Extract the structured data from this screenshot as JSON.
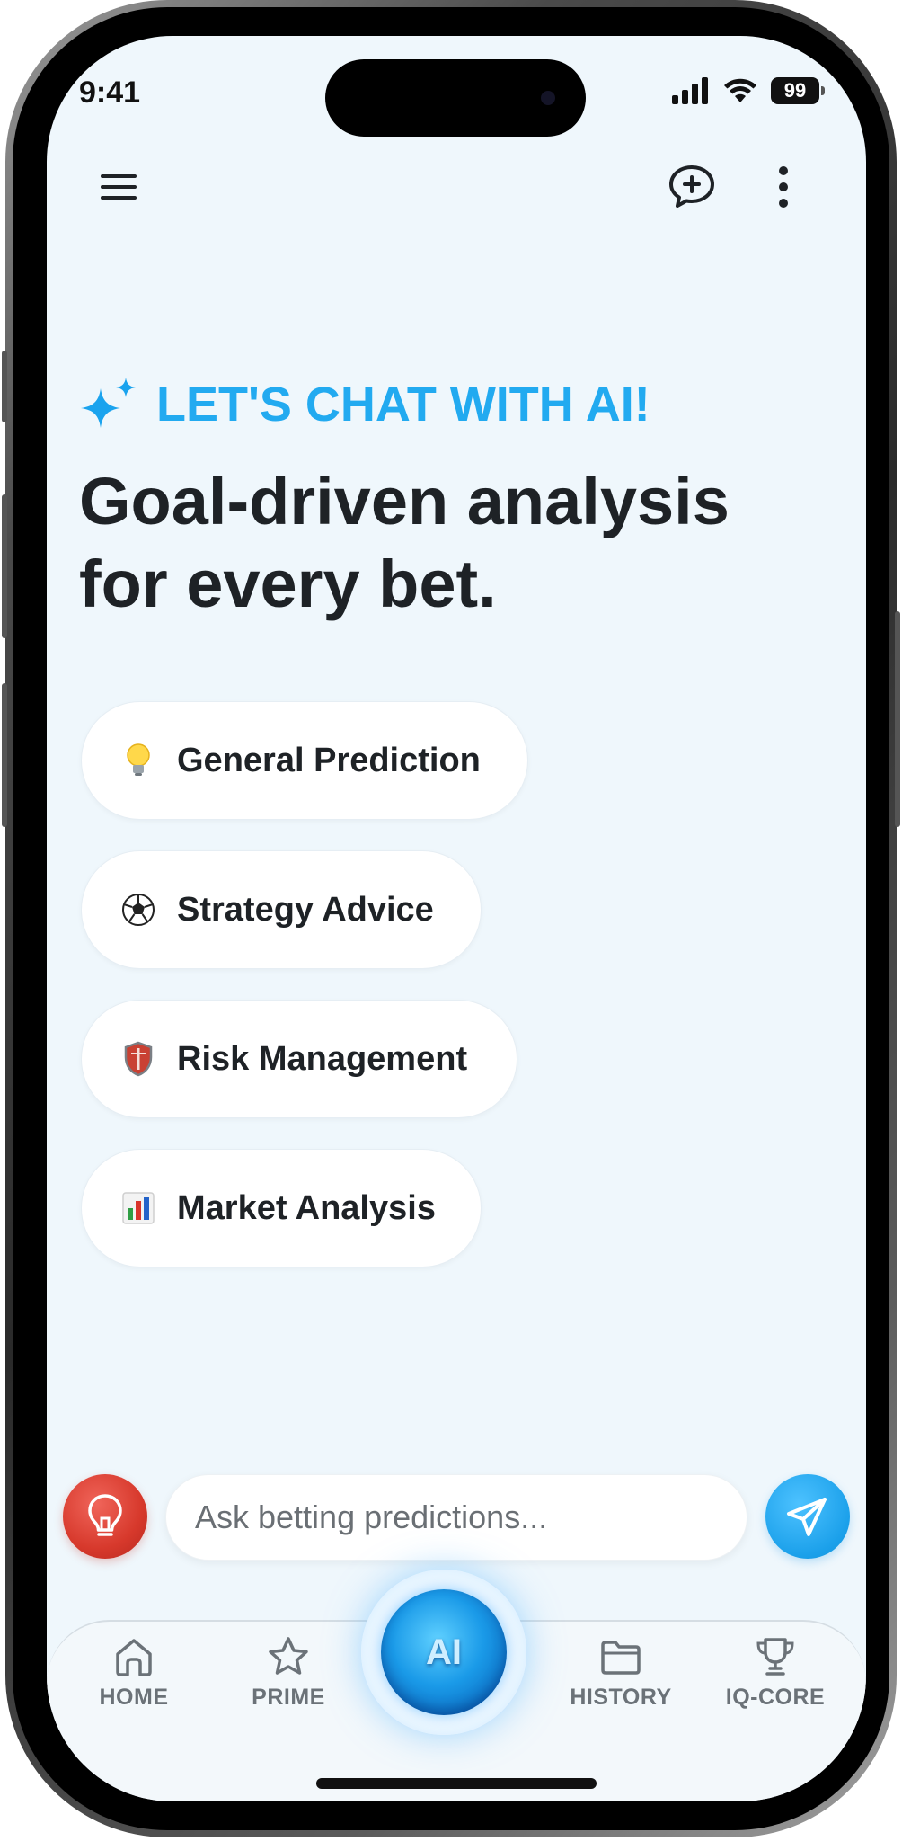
{
  "status_bar": {
    "time": "9:41",
    "battery": "99",
    "icons": [
      "signal-icon",
      "wifi-icon",
      "battery-icon"
    ]
  },
  "top_bar": {
    "icons": [
      "menu-icon",
      "new-chat-icon",
      "more-icon"
    ]
  },
  "hero": {
    "kicker_icon": "sparkle-icon",
    "kicker": "LET'S CHAT WITH AI!",
    "headline": "Goal-driven analysis for every bet."
  },
  "suggestions": [
    {
      "emoji": "lightbulb-icon",
      "label": "General Prediction"
    },
    {
      "emoji": "soccer-ball-icon",
      "label": "Strategy Advice"
    },
    {
      "emoji": "shield-icon",
      "label": "Risk Management"
    },
    {
      "emoji": "bar-chart-icon",
      "label": "Market Analysis"
    }
  ],
  "composer": {
    "idea_icon": "lightbulb-icon",
    "placeholder": "Ask betting predictions...",
    "send_icon": "send-icon"
  },
  "tabbar": {
    "tabs": [
      {
        "label": "HOME",
        "icon": "home-icon"
      },
      {
        "label": "PRIME",
        "icon": "star-icon"
      },
      {
        "label": "HISTORY",
        "icon": "folder-icon"
      },
      {
        "label": "IQ-CORE",
        "icon": "trophy-icon"
      }
    ],
    "center_label": "AI"
  },
  "colors": {
    "accent": "#22aaf0",
    "screen_bg": "#eff7fc",
    "text_dark": "#1e2226",
    "idea_red": "#d7392c",
    "send_blue": "#1ba0ea"
  }
}
